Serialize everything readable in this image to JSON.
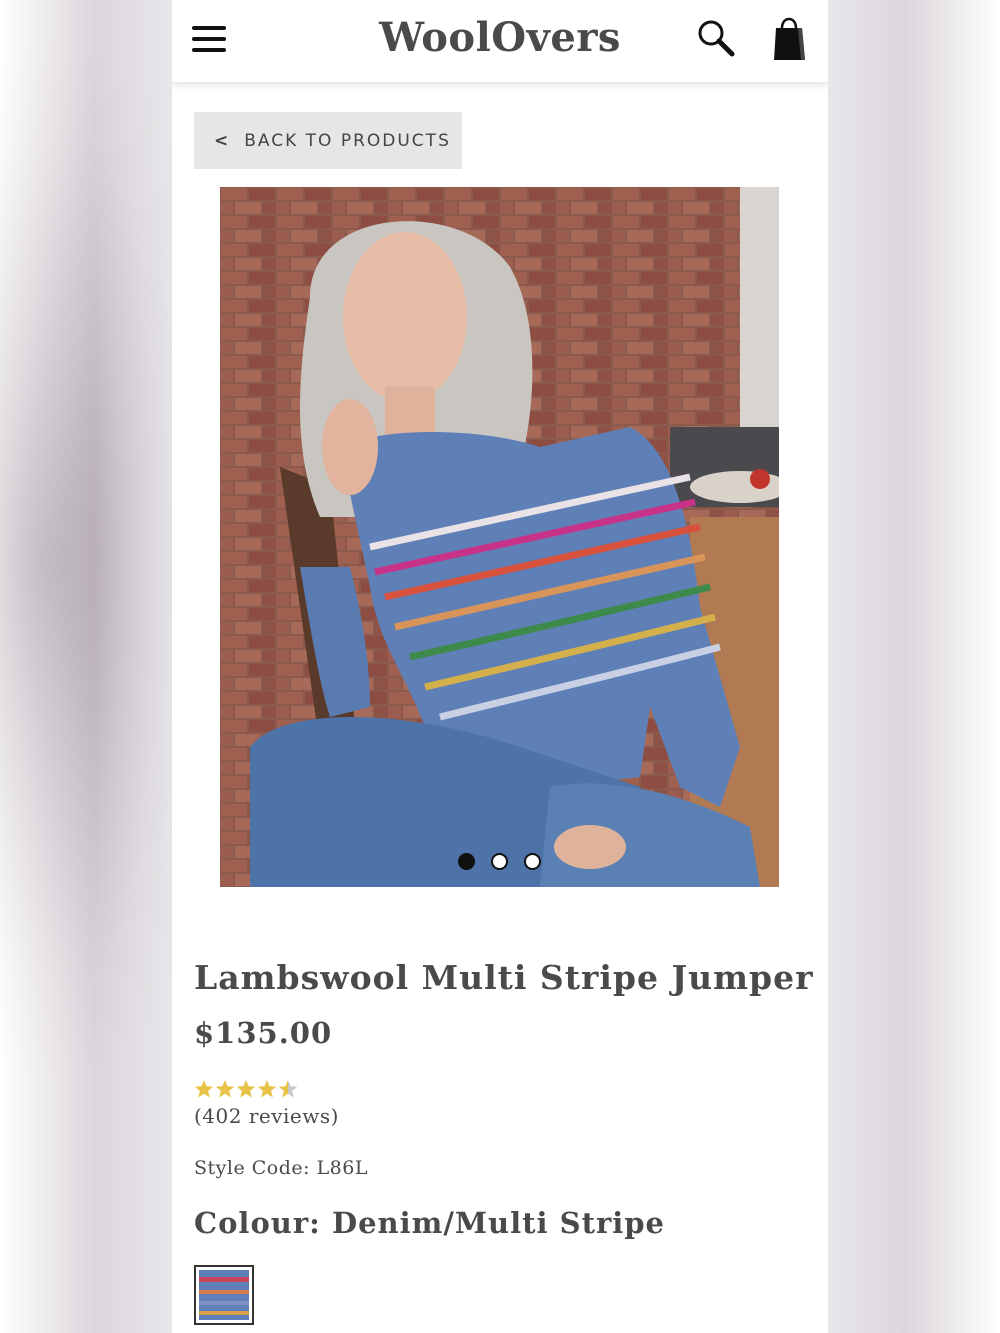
{
  "header": {
    "logo": "WoolOvers",
    "icons": [
      "menu-icon",
      "search-icon",
      "shopping-bag-icon"
    ]
  },
  "navigation": {
    "back_label": "BACK TO PRODUCTS",
    "back_chevron": "<"
  },
  "gallery": {
    "image_count": 3,
    "active_index": 0
  },
  "product": {
    "title": "Lambswool Multi Stripe Jumper",
    "price": "$135.00",
    "rating": 4.5,
    "rating_max": 5,
    "reviews": "(402 reviews)",
    "style_code": "Style Code: L86L",
    "colour": "Colour: Denim/Multi Stripe"
  },
  "colors": {
    "text": "#4a4a4a",
    "star": "#e8c34a",
    "star_empty": "#c9c9c9",
    "button_bg": "#e6e6e6"
  }
}
